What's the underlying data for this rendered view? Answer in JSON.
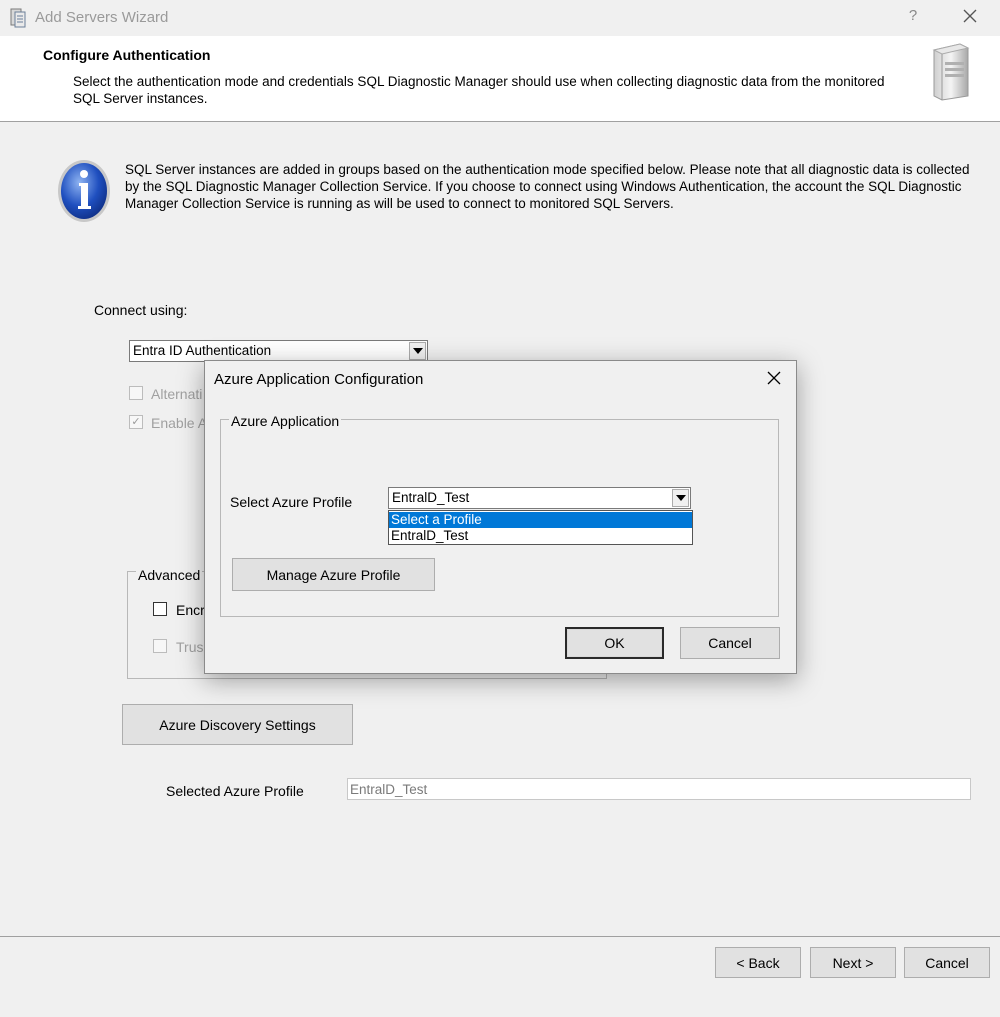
{
  "window": {
    "title": "Add Servers Wizard",
    "help_symbol": "?",
    "icons": {
      "app": "server-stack-icon",
      "close": "close-icon"
    }
  },
  "header": {
    "title": "Configure Authentication",
    "description": "Select the authentication mode and credentials SQL Diagnostic Manager should use when collecting diagnostic data from the monitored SQL Server instances.",
    "icon": "server-icon"
  },
  "info": {
    "icon": "info-icon",
    "text": "SQL Server instances are added in groups based on the authentication mode specified below. Please note that all diagnostic data is collected by the SQL Diagnostic Manager Collection Service. If you choose to connect using Windows Authentication, the account the SQL Diagnostic Manager Collection Service is running as will be used to connect to monitored SQL Servers."
  },
  "connect": {
    "label": "Connect using:",
    "auth_mode": "Entra ID Authentication",
    "alternate_label": "Alternati",
    "alternate_checked": false,
    "enable_label": "Enable A",
    "enable_checked": true
  },
  "advanced": {
    "legend": "Advanced",
    "encrypt_label": "Encr",
    "encrypt_checked": false,
    "trust_label": "Trus",
    "trust_checked": false
  },
  "azure": {
    "discovery_button": "Azure Discovery Settings",
    "selected_profile_label": "Selected Azure Profile",
    "selected_profile_value": "EntralD_Test"
  },
  "footer": {
    "back": "< Back",
    "next": "Next >",
    "cancel": "Cancel"
  },
  "dialog": {
    "title": "Azure Application Configuration",
    "group_legend": "Azure Application",
    "select_label": "Select Azure Profile",
    "selected_value": "EntralD_Test",
    "options": [
      "Select a Profile",
      "EntralD_Test"
    ],
    "highlighted_option_index": 0,
    "manage_button": "Manage Azure Profile",
    "ok": "OK",
    "cancel": "Cancel",
    "accent_color": "#0078d7"
  }
}
